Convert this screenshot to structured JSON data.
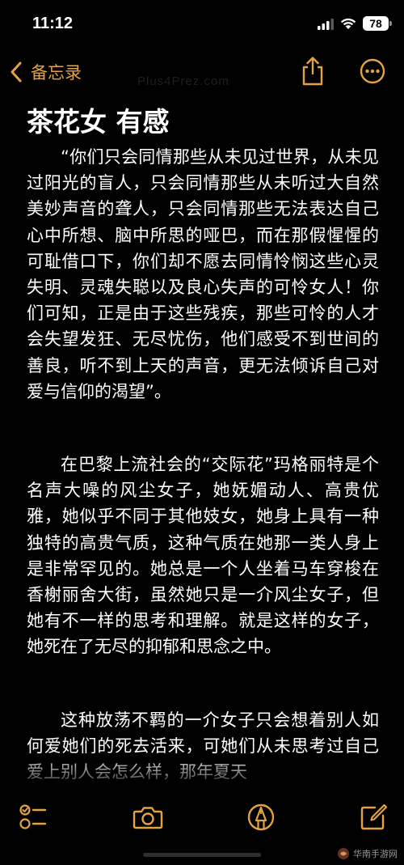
{
  "status_bar": {
    "time": "11:12",
    "battery": "78"
  },
  "nav": {
    "back_label": "备忘录"
  },
  "watermark": "Plus4Prez.com",
  "note": {
    "title": "茶花女 有感",
    "paragraphs": [
      "“你们只会同情那些从未见过世界，从未见过阳光的盲人，只会同情那些从未听过大自然美妙声音的聋人，只会同情那些无法表达自己心中所想、脑中所思的哑巴，而在那假惺惺的可耻借口下，你们却不愿去同情怜悯这些心灵失明、灵魂失聪以及良心失声的可怜女人！你们可知，正是由于这些残疾，那些可怜的人才会失望发狂、无尽忧伤，他们感受不到世间的善良，听不到上天的声音，更无法倾诉自己对爱与信仰的渴望”。",
      "在巴黎上流社会的“交际花”玛格丽特是个名声大噪的风尘女子，她妩媚动人、高贵优雅，她似乎不同于其他妓女，她身上具有一种独特的高贵气质，这种气质在她那一类人身上是非常罕见的。她总是一个人坐着马车穿梭在香榭丽舍大街，虽然她只是一介风尘女子，但她有不一样的思考和理解。就是这样的女子，她死在了无尽的抑郁和思念之中。",
      "这种放荡不羁的一介女子只会想着别人如何爱她们的死去活来，可她们从未思考过自己爱上别人会怎么样，那年夏天"
    ]
  },
  "toolbar": {
    "checklist": "checklist-icon",
    "camera": "camera-icon",
    "markup": "markup-pen-icon",
    "compose": "compose-icon"
  },
  "badge": {
    "text": "华南手游网"
  },
  "colors": {
    "accent": "#e5a33f",
    "background": "#000000",
    "text": "#ffffff"
  }
}
